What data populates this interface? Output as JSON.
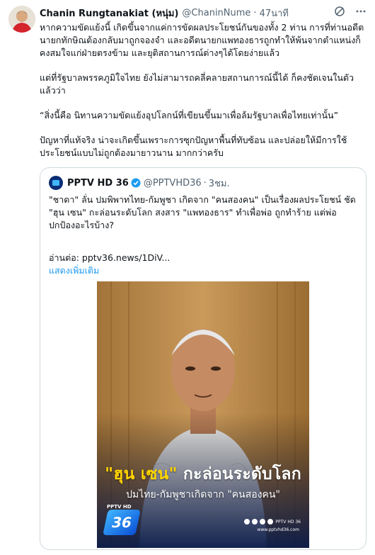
{
  "author": {
    "name": "Chanin Rungtanakiat (หนุ่ม)",
    "handle": "@ChaninNume",
    "separator": "·",
    "time": "47นาที"
  },
  "header_icons": [
    "grok-icon",
    "more-icon"
  ],
  "tweet": {
    "paragraphs": [
      "หากความขัดแย้งนี้ เกิดขึ้นจากแค่การขัดผลประโยชน์กันของทั้ง 2 ท่าน การที่ท่านอดีตนายกทักษิณต้องกลับมาถูกจองจำ และอดีตนายกแพทองธารถูกทำให้พ้นจากตำแหน่งก็คงสมใจแก่ฝ่ายตรงข้าม และยุติสถานการณ์ต่างๆได้โดยง่ายแล้ว",
      "แต่ที่รัฐบาลพรรคภูมิใจไทย ยังไม่สามารถคลี่คลายสถานการณ์นี้ได้ ก็คงชัดเจนในตัวแล้วว่า",
      "“สิ่งนี้คือ นิทานความขัดแย้งอุปโลกน์ที่เขียนขึ้นมาเพื่อล้มรัฐบาลเพื่อไทยเท่านั้น”",
      "ปัญหาที่แท้จริง น่าจะเกิดขึ้นเพราะการซุกปัญหาพื้นที่ทับซ้อน และปล่อยให้มีการใช้ประโยชน์แบบไม่ถูกต้องมายาวนาน มากกว่าครับ"
    ]
  },
  "quote": {
    "name": "PPTV HD 36",
    "handle": "@PPTVHD36",
    "separator": "·",
    "time": "3ชม.",
    "text": "\"ชาดา\" ลั่น ปมพิพาทไทย-กัมพูชา เกิดจาก \"คนสองคน\" เป็นเรื่องผลประโยชน์ ชัด \"ฮุน เซน\" กะล่อนระดับโลก สงสาร \"แพทองธาร\" ทำเพื่อพ่อ ถูกทำร้าย แต่พ่อปกป้องอะไรบ้าง?",
    "read_more": "อ่านต่อ: pptv36.news/1DiV...",
    "show_more": "แสดงเพิ่มเติม",
    "media": {
      "headline_yellow": "\"ฮุน เซน\"",
      "headline_white": " กะล่อนระดับโลก",
      "subheadline": "ปมไทย-กัมพูชาเกิดจาก \"คนสองคน\"",
      "logo_text": "36",
      "logo_label": "PPTV HD",
      "social_label": "PPTV HD 36",
      "website": "www.pptvhd36.com"
    }
  },
  "colors": {
    "accent": "#1d9bf0",
    "secondary_text": "#536471",
    "border": "#cfd9de",
    "headline_yellow": "#ffd400"
  }
}
